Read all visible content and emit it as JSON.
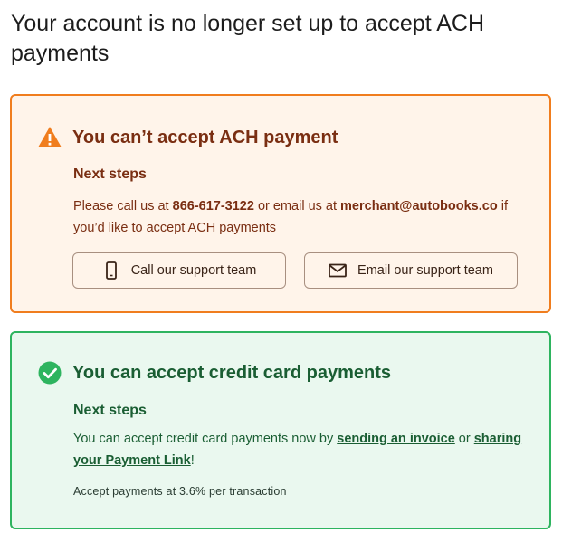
{
  "page": {
    "title": "Your account is no longer set up to accept ACH payments"
  },
  "ach_card": {
    "icon": "warning-icon",
    "title": "You can’t accept ACH payment",
    "next_steps_label": "Next steps",
    "text_before_phone": "Please call us at ",
    "phone": "866-617-3122",
    "text_between": " or email us at ",
    "email": "merchant@autobooks.co",
    "text_after_email": " if you’d like to accept ACH payments",
    "call_button_label": "Call our support team",
    "call_button_icon": "phone-icon",
    "email_button_label": "Email our support team",
    "email_button_icon": "mail-icon",
    "colors": {
      "border": "#f07d1e",
      "background": "#fff4ea",
      "text": "#7a2e12"
    }
  },
  "cc_card": {
    "icon": "check-circle-icon",
    "title": "You can accept credit card payments",
    "next_steps_label": "Next steps",
    "text_before_link1": "You can accept credit card payments now by ",
    "link1_label": "sending an invoice",
    "text_between_links": " or ",
    "link2_label": "sharing your Payment Link",
    "text_after_link2": "!",
    "fee_text": "Accept payments at 3.6% per transaction",
    "colors": {
      "border": "#2eb45f",
      "background": "#eaf8ef",
      "text": "#1a5e33"
    }
  }
}
